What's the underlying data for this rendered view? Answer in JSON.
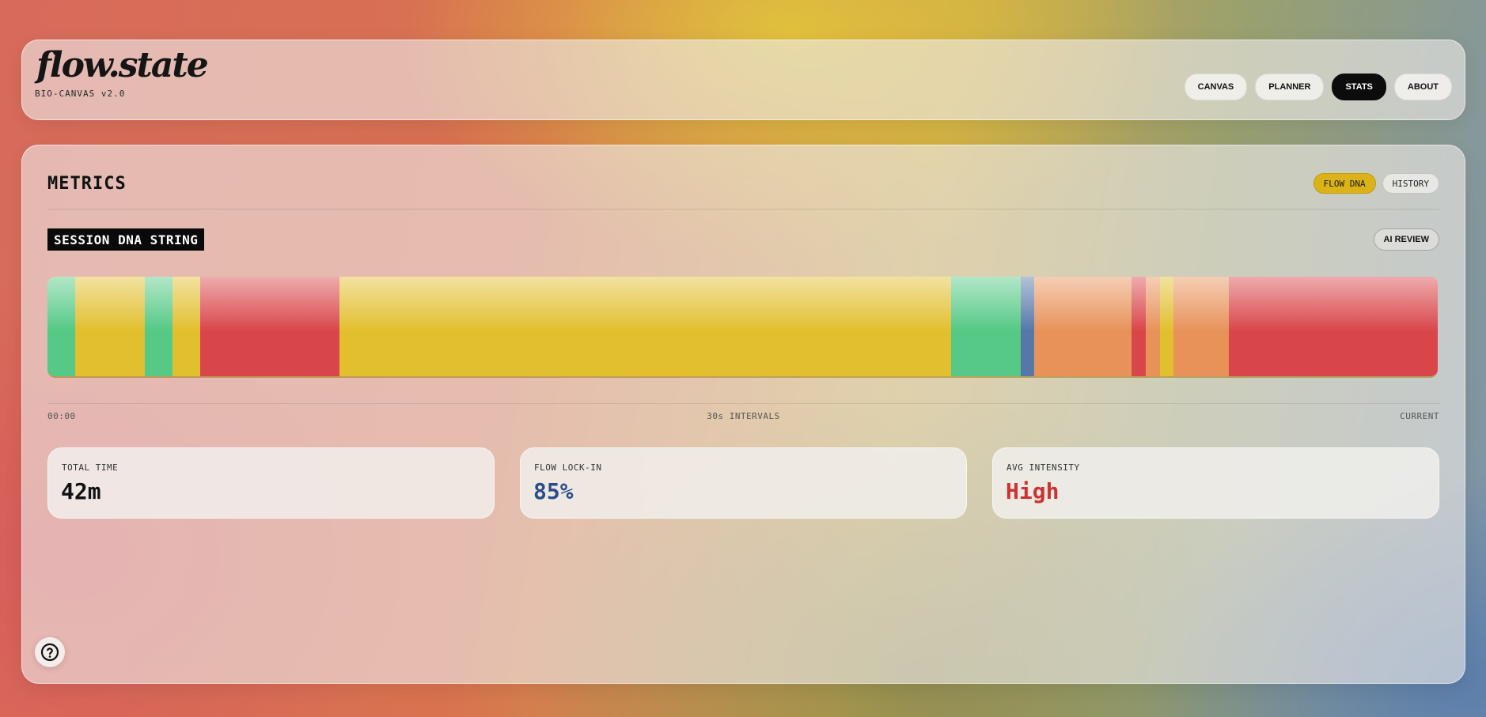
{
  "header": {
    "logo": "flow.state",
    "subtitle": "BIO-CANVAS v2.0",
    "nav": [
      {
        "label": "CANVAS",
        "active": false
      },
      {
        "label": "PLANNER",
        "active": false
      },
      {
        "label": "STATS",
        "active": true
      },
      {
        "label": "ABOUT",
        "active": false
      }
    ]
  },
  "metrics": {
    "title": "METRICS",
    "tabs": [
      {
        "label": "FLOW DNA",
        "active": true
      },
      {
        "label": "HISTORY",
        "active": false
      }
    ],
    "section_label": "SESSION DNA STRING",
    "ai_review_label": "AI REVIEW",
    "timeline": {
      "start": "00:00",
      "interval": "30s INTERVALS",
      "end": "CURRENT"
    },
    "dna_segments": [
      {
        "state": "green",
        "units": 2
      },
      {
        "state": "yellow",
        "units": 5
      },
      {
        "state": "green",
        "units": 2
      },
      {
        "state": "yellow",
        "units": 2
      },
      {
        "state": "red",
        "units": 10
      },
      {
        "state": "yellow",
        "units": 44
      },
      {
        "state": "green",
        "units": 5
      },
      {
        "state": "blue",
        "units": 1
      },
      {
        "state": "orange",
        "units": 7
      },
      {
        "state": "red",
        "units": 1
      },
      {
        "state": "orange",
        "units": 1
      },
      {
        "state": "yellow",
        "units": 1
      },
      {
        "state": "orange",
        "units": 4
      },
      {
        "state": "red",
        "units": 15
      }
    ],
    "state_colors": {
      "green": "#55c985",
      "yellow": "#e2bf2e",
      "red": "#d9464a",
      "orange": "#e8925a",
      "blue": "#5578a8"
    },
    "stats": [
      {
        "label": "TOTAL TIME",
        "value": "42m",
        "color": "#111111"
      },
      {
        "label": "FLOW LOCK-IN",
        "value": "85%",
        "color": "#2a4d8a"
      },
      {
        "label": "AVG INTENSITY",
        "value": "High",
        "color": "#cc3333"
      }
    ]
  },
  "help": {
    "icon": "help-icon"
  }
}
